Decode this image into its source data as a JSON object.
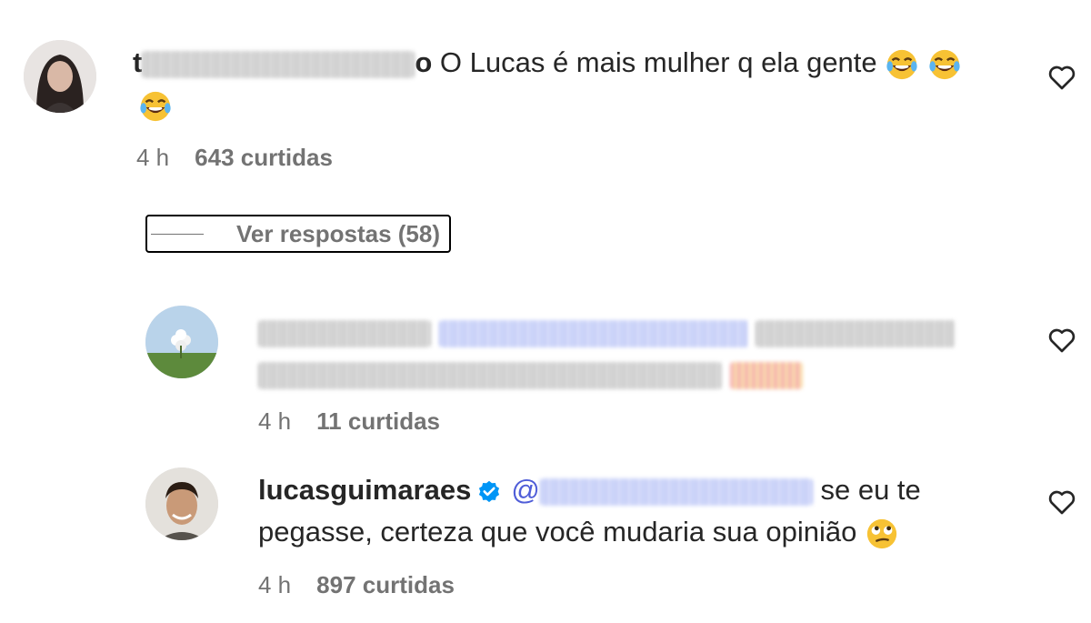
{
  "comments": [
    {
      "username_visible": "t",
      "username_suffix": "o",
      "text": "O Lucas é mais mulher q ela gente",
      "emojis": [
        "joy-emoji",
        "joy-emoji",
        "joy-emoji"
      ],
      "time": "4 h",
      "likes": "643 curtidas"
    },
    {
      "time": "4 h",
      "likes": "11 curtidas"
    },
    {
      "username": "lucasguimaraes",
      "mention_prefix": "@",
      "text_line1": "se eu te",
      "text_line2": "pegasse, certeza que você mudaria sua opinião",
      "emoji": "face-with-rolling-eyes-emoji",
      "time": "4 h",
      "likes": "897 curtidas"
    }
  ],
  "replies_button": {
    "label": "Ver respostas (58)"
  },
  "colors": {
    "text": "#262626",
    "meta": "#737373",
    "mention": "#4f5dd8",
    "verified": "#0095f6"
  }
}
